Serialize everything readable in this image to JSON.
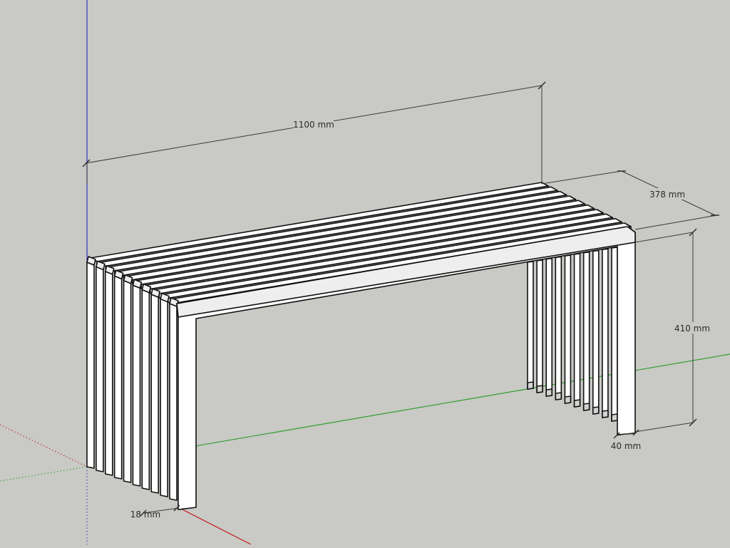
{
  "dimensions": {
    "length": "1100 mm",
    "depth": "378 mm",
    "height": "410 mm",
    "slat_gap": "40 mm",
    "slat_thickness": "18 mm"
  },
  "axis_colors": {
    "blue": "#2f2fc8",
    "green": "#2e9e2e",
    "red": "#c02020"
  }
}
